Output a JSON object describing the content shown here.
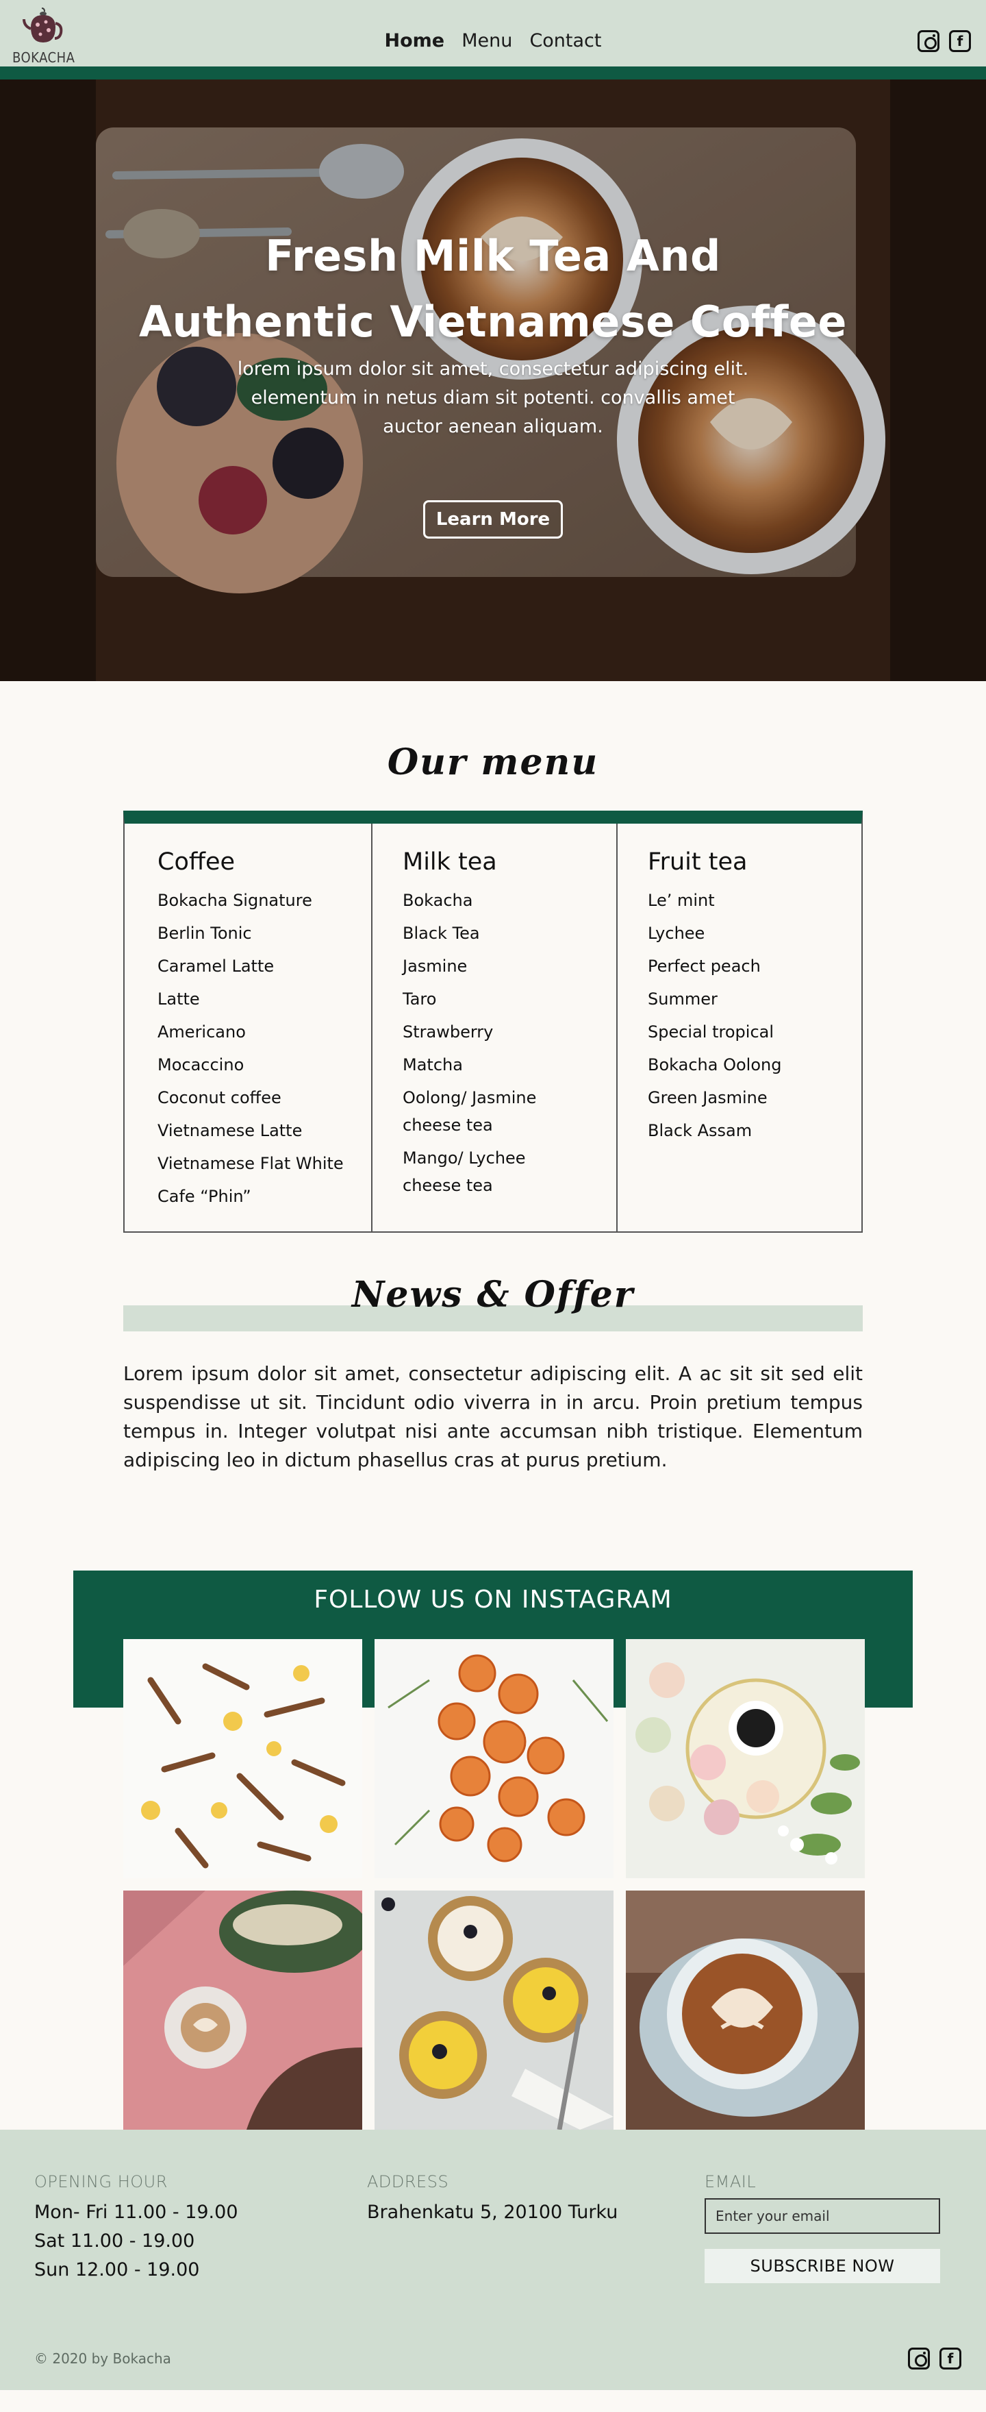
{
  "brand": {
    "name": "BOKACHA"
  },
  "nav": {
    "items": [
      "Home",
      "Menu",
      "Contact"
    ],
    "active": "Home"
  },
  "social": {
    "instagram_icon": "instagram-icon",
    "facebook_icon": "facebook-icon",
    "facebook_glyph": "f"
  },
  "hero": {
    "title_line1": "Fresh Milk Tea And",
    "title_line2": "Authentic Vietnamese Coffee",
    "text": "lorem ipsum dolor sit amet, consectetur adipiscing elit. elementum in netus diam sit potenti. convallis amet auctor aenean aliquam.",
    "button": "Learn More"
  },
  "menu": {
    "title": "Our menu",
    "columns": [
      {
        "heading": "Coffee",
        "items": [
          "Bokacha Signature",
          "Berlin Tonic",
          "Caramel Latte",
          "Latte",
          "Americano",
          "Mocaccino",
          "Coconut coffee",
          "Vietnamese Latte",
          "Vietnamese Flat White",
          "Cafe “Phin”"
        ]
      },
      {
        "heading": "Milk tea",
        "items": [
          "Bokacha",
          "Black Tea",
          "Jasmine",
          "Taro",
          "Strawberry",
          "Matcha",
          "Oolong/ Jasmine cheese tea",
          "Mango/ Lychee cheese tea"
        ]
      },
      {
        "heading": "Fruit tea",
        "items": [
          "Le’ mint",
          "Lychee",
          "Perfect peach",
          "Summer",
          "Special tropical",
          "Bokacha Oolong",
          "Green Jasmine",
          "Black Assam"
        ]
      }
    ]
  },
  "news": {
    "title": "News & Offer",
    "text": "Lorem ipsum dolor sit amet, consectetur adipiscing elit. A ac sit sit sed elit suspendisse ut sit. Tincidunt odio viverra in in arcu. Proin pretium tempus tempus in. Integer volutpat nisi ante accumsan nibh tristique. Elementum adipiscing leo in dictum phasellus cras at purus pretium."
  },
  "instagram": {
    "title": "FOLLOW US ON INSTAGRAM"
  },
  "footer": {
    "hours_label": "OPENING HOUR",
    "hours": [
      "Mon- Fri 11.00 - 19.00",
      "Sat 11.00 - 19.00",
      "Sun 12.00 - 19.00"
    ],
    "address_label": "ADDRESS",
    "address": "Brahenkatu 5, 20100 Turku",
    "email_label": "EMAIL",
    "email_placeholder": "Enter your email",
    "subscribe": "SUBSCRIBE NOW",
    "copyright": "© 2020 by Bokacha"
  },
  "colors": {
    "brand_green": "#0f5a43",
    "header_bg": "#d3dfd4",
    "page_bg": "#fbf9f5"
  }
}
